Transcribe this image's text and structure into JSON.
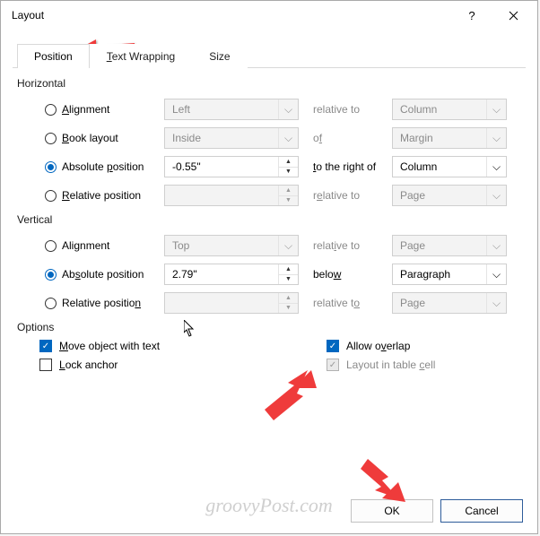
{
  "window": {
    "title": "Layout",
    "help": "?",
    "close": "✕"
  },
  "tabs": {
    "position": "Position",
    "text_wrapping": "Text Wrapping",
    "size": "Size"
  },
  "groups": {
    "horizontal": "Horizontal",
    "vertical": "Vertical",
    "options": "Options"
  },
  "h": {
    "alignment": {
      "label": "Alignment",
      "value": "Left",
      "rel_label": "relative to",
      "rel_value": "Column"
    },
    "book": {
      "label": "Book layout",
      "value": "Inside",
      "rel_label": "of",
      "rel_value": "Margin"
    },
    "abs": {
      "label": "Absolute position",
      "value": "-0.55\"",
      "rel_label": "to the right of",
      "rel_value": "Column"
    },
    "rel": {
      "label": "Relative position",
      "value": "",
      "rel_label": "relative to",
      "rel_value": "Page"
    }
  },
  "v": {
    "alignment": {
      "label": "Alignment",
      "value": "Top",
      "rel_label": "relative to",
      "rel_value": "Page"
    },
    "abs": {
      "label": "Absolute position",
      "value": "2.79\"",
      "rel_label": "below",
      "rel_value": "Paragraph"
    },
    "rel": {
      "label": "Relative position",
      "value": "",
      "rel_label": "relative to",
      "rel_value": "Page"
    }
  },
  "opts": {
    "move_with_text": "Move object with text",
    "lock_anchor": "Lock anchor",
    "allow_overlap": "Allow overlap",
    "layout_in_cell": "Layout in table cell"
  },
  "footer": {
    "ok": "OK",
    "cancel": "Cancel"
  },
  "watermark": "groovyPost.com"
}
